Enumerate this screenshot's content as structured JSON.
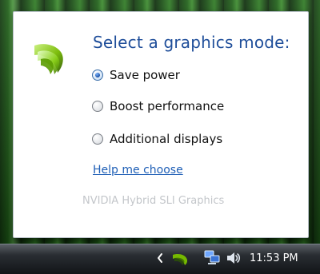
{
  "popup": {
    "title": "Select a graphics mode:",
    "options": [
      {
        "label": "Save power",
        "selected": true
      },
      {
        "label": "Boost performance",
        "selected": false
      },
      {
        "label": "Additional displays",
        "selected": false
      }
    ],
    "help_link": "Help me choose",
    "brand_footer": "NVIDIA Hybrid SLI Graphics"
  },
  "taskbar": {
    "tray_icons": [
      "show-hidden-icons-chevron-icon",
      "nvidia-icon",
      "network-icon",
      "volume-icon"
    ],
    "clock": "11:53 PM"
  },
  "colors": {
    "title": "#1f4e9a",
    "link": "#1f5fb6",
    "brand_footer": "#c3c6ca",
    "taskbar": "#121417",
    "nvidia_green": "#76b900"
  }
}
